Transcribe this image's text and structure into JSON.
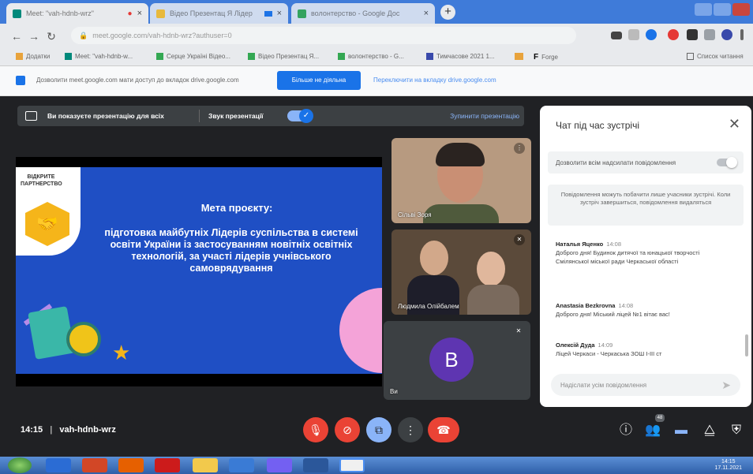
{
  "browser": {
    "tabs": [
      {
        "title": "Meet: \"vah-hdnb-wrz\"",
        "active": true
      },
      {
        "title": "Відео Презентац Я Лідер",
        "active": false
      },
      {
        "title": "волонтерство - Google Дос",
        "active": false
      }
    ],
    "address": "meet.google.com/vah-hdnb-wrz?authuser=0",
    "bookmarks": [
      "Додатки",
      "Meet: \"vah-hdnb-w...",
      "Серце Україні Відео...",
      "Відео Презентац Я...",
      "волонтерство - G...",
      "Тимчасове 2021 1...",
      "Forge"
    ],
    "bookmarks_right": "Список читання"
  },
  "infobar": {
    "text": "Дозволити meet.google.com мати доступ до вкладок drive.google.com",
    "enable_button": "Більше не діяльна",
    "link": "Переключити на вкладку drive.google.com"
  },
  "presentation_bar": {
    "text": "Ви показуєте презентацію для всіх",
    "sound_label": "Звук презентації",
    "stop_label": "Зупинити презентацію"
  },
  "slide": {
    "logo_text": "ВІДКРИТЕ ПАРТНЕРСТВО",
    "title": "Мета проєкту:",
    "body": "підготовка майбутніх Лідерів суспільства в системі освіти України із застосуванням новітніх освітніх технологій, за участі лідерів учнівського самоврядування"
  },
  "participants": [
    {
      "name": "Сільві Зоря"
    },
    {
      "name": "Людмила Олійбалем"
    },
    {
      "name": "Ви",
      "avatar_letter": "B"
    }
  ],
  "chat": {
    "title": "Чат під час зустрічі",
    "permit_label": "Дозволити всім надсилати повідомлення",
    "notice": "Повідомлення можуть побачити лише учасники зустрічі. Коли зустріч завершиться, повідомлення видаляться",
    "messages": [
      {
        "author": "Наталья Яценко",
        "time": "14:08",
        "text": "Доброго дня! Будинок дитячої та юнацької творчості Смілянської міської ради Черкаської області"
      },
      {
        "author": "Anastasia Bezkrovna",
        "time": "14:08",
        "text": "Доброго дня! Міський ліцей №1 вітає вас!"
      },
      {
        "author": "Олексій Дуда",
        "time": "14:09",
        "text": "Ліцей Черкаси - Черкаська ЗОШ І-ІІІ ст"
      }
    ],
    "input_placeholder": "Надіслати усім повідомлення"
  },
  "bottom": {
    "time": "14:15",
    "meeting_code": "vah-hdnb-wrz",
    "participants_badge": "48"
  },
  "taskbar": {
    "time": "14:15",
    "date": "17.11.2021"
  },
  "colors": {
    "tab_bar": "#3f7bd9",
    "meet_bg": "#202124",
    "slide_bg": "#1f4fc4",
    "hangup": "#ea4335",
    "accent": "#1a73e8"
  }
}
